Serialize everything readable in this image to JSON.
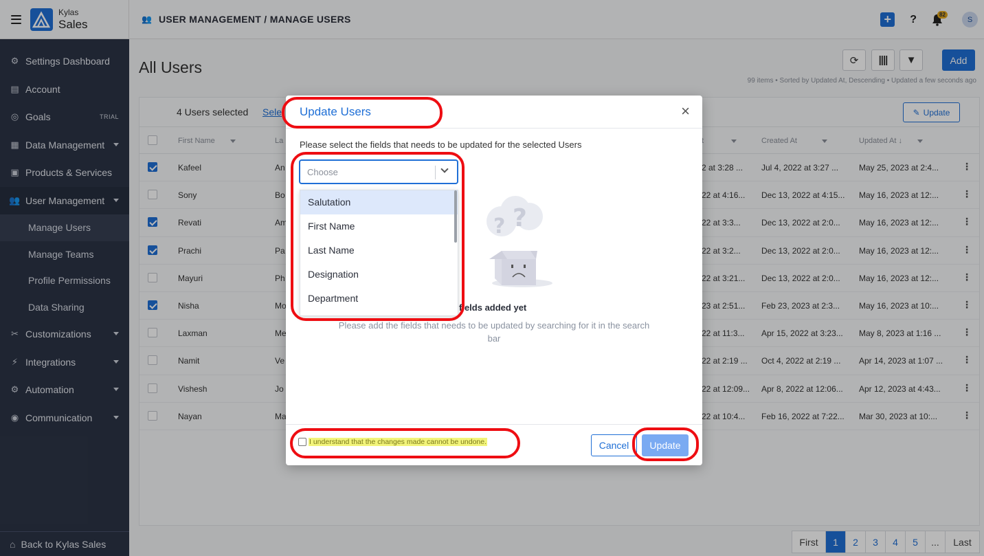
{
  "brand": {
    "top": "Kylas",
    "bottom": "Sales"
  },
  "sidebar": {
    "items": [
      {
        "label": "Settings Dashboard",
        "icon": "gear-icon"
      },
      {
        "label": "Account",
        "icon": "id-card-icon"
      },
      {
        "label": "Goals",
        "icon": "target-icon",
        "badge": "TRIAL"
      },
      {
        "label": "Data Management",
        "icon": "table-icon",
        "caret": true
      },
      {
        "label": "Products & Services",
        "icon": "box-icon"
      },
      {
        "label": "User Management",
        "icon": "users-icon",
        "caret": true
      }
    ],
    "sub_items": [
      "Manage Users",
      "Manage Teams",
      "Profile Permissions",
      "Data Sharing"
    ],
    "items_after": [
      {
        "label": "Customizations",
        "icon": "tools-icon"
      },
      {
        "label": "Integrations",
        "icon": "plug-icon"
      },
      {
        "label": "Automation",
        "icon": "cogs-icon"
      },
      {
        "label": "Communication",
        "icon": "broadcast-icon"
      }
    ],
    "back_label": "Back to Kylas Sales"
  },
  "header": {
    "breadcrumb": "USER MANAGEMENT / MANAGE USERS",
    "help": "?",
    "notifications": "82",
    "avatar": "S"
  },
  "page": {
    "title": "All Users",
    "add_label": "Add",
    "meta": "99 items • Sorted by Updated At, Descending • Updated a few seconds ago"
  },
  "selection": {
    "count_text": "4 Users selected",
    "link_text": "Sele",
    "update_label": "Update"
  },
  "table": {
    "headers": [
      "First Name",
      "La",
      "t",
      "Created At",
      "Updated At ↓"
    ],
    "rows": [
      {
        "checked": true,
        "first": "Kafeel",
        "last": "An",
        "c3": "2 at 3:28 ...",
        "created": "Jul 4, 2022 at 3:27 ...",
        "updated": "May 25, 2023 at 2:4..."
      },
      {
        "checked": false,
        "first": "Sony",
        "last": "Bo",
        "c3": "22 at 4:16...",
        "created": "Dec 13, 2022 at 4:15...",
        "updated": "May 16, 2023 at 12:..."
      },
      {
        "checked": true,
        "first": "Revati",
        "last": "Am",
        "c3": "22 at 3:3...",
        "created": "Dec 13, 2022 at 2:0...",
        "updated": "May 16, 2023 at 12:..."
      },
      {
        "checked": true,
        "first": "Prachi",
        "last": "Pa",
        "c3": "22 at 3:2...",
        "created": "Dec 13, 2022 at 2:0...",
        "updated": "May 16, 2023 at 12:..."
      },
      {
        "checked": false,
        "first": "Mayuri",
        "last": "Ph",
        "c3": "22 at 3:21...",
        "created": "Dec 13, 2022 at 2:0...",
        "updated": "May 16, 2023 at 12:..."
      },
      {
        "checked": true,
        "first": "Nisha",
        "last": "Mo",
        "c3": "23 at 2:51...",
        "created": "Feb 23, 2023 at 2:3...",
        "updated": "May 16, 2023 at 10:..."
      },
      {
        "checked": false,
        "first": "Laxman",
        "last": "Me",
        "c3": "22 at 11:3...",
        "created": "Apr 15, 2022 at 3:23...",
        "updated": "May 8, 2023 at 1:16 ..."
      },
      {
        "checked": false,
        "first": "Namit",
        "last": "Ve",
        "c3": "22 at 2:19 ...",
        "created": "Oct 4, 2022 at 2:19 ...",
        "updated": "Apr 14, 2023 at 1:07 ..."
      },
      {
        "checked": false,
        "first": "Vishesh",
        "last": "Jo",
        "c3": "22 at 12:09...",
        "created": "Apr 8, 2022 at 12:06...",
        "updated": "Apr 12, 2023 at 4:43..."
      },
      {
        "checked": false,
        "first": "Nayan",
        "last": "Ma",
        "c3": "22 at 10:4...",
        "created": "Feb 16, 2022 at 7:22...",
        "updated": "Mar 30, 2023 at 10:..."
      }
    ]
  },
  "pagination": {
    "first": "First",
    "pages": [
      "1",
      "2",
      "3",
      "4",
      "5",
      "..."
    ],
    "current": "1",
    "last": "Last"
  },
  "modal": {
    "title": "Update Users",
    "close": "×",
    "description": "Please select the fields that needs to be updated for the selected Users",
    "select_placeholder": "Choose",
    "options": [
      "Salutation",
      "First Name",
      "Last Name",
      "Designation",
      "Department"
    ],
    "empty_title": "fields added yet",
    "empty_subtitle": "Please add the fields that needs to be updated by searching for it in the search bar",
    "ack_text": "I understand that the changes made cannot be undone.",
    "cancel_label": "Cancel",
    "update_label": "Update"
  },
  "colors": {
    "accent": "#1f6fd6",
    "sidebar": "#2c3446",
    "annotation": "#ee0d12",
    "highlight": "#f2f47a"
  }
}
